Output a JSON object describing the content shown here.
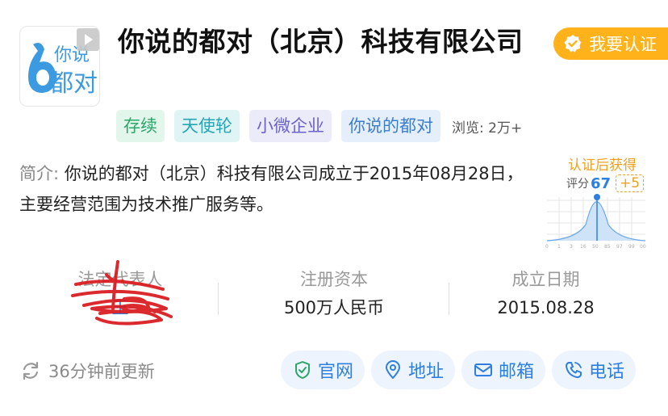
{
  "company": {
    "logo_text": "你说的都对",
    "name": "你说的都对（北京）科技有限公司"
  },
  "cert_button": {
    "label": "我要认证",
    "icon": "check-badge-icon"
  },
  "tags": [
    "存续",
    "天使轮",
    "小微企业",
    "你说的都对"
  ],
  "views": "浏览: 2万+",
  "intro": {
    "label": "简介: ",
    "text": "你说的都对（北京）科技有限公司成立于2015年08月28日，主要经营范围为技术推广服务等。"
  },
  "score": {
    "title": "认证后获得",
    "label": "评分",
    "value": "67",
    "bonus": "+5",
    "axis_ticks": [
      "0",
      "1",
      "3",
      "16",
      "50",
      "85",
      "97",
      "99",
      "00"
    ]
  },
  "stats": {
    "legal_rep": {
      "label": "法定代表人",
      "value": "王"
    },
    "reg_capital": {
      "label": "注册资本",
      "value": "500万人民币"
    },
    "founded": {
      "label": "成立日期",
      "value": "2015.08.28"
    }
  },
  "updated": "36分钟前更新",
  "actions": {
    "website": "官网",
    "address": "地址",
    "email": "邮箱",
    "phone": "电话"
  },
  "colors": {
    "accent": "#2d7fe0",
    "cert": "#ffb21a",
    "redact": "#d9191d"
  }
}
